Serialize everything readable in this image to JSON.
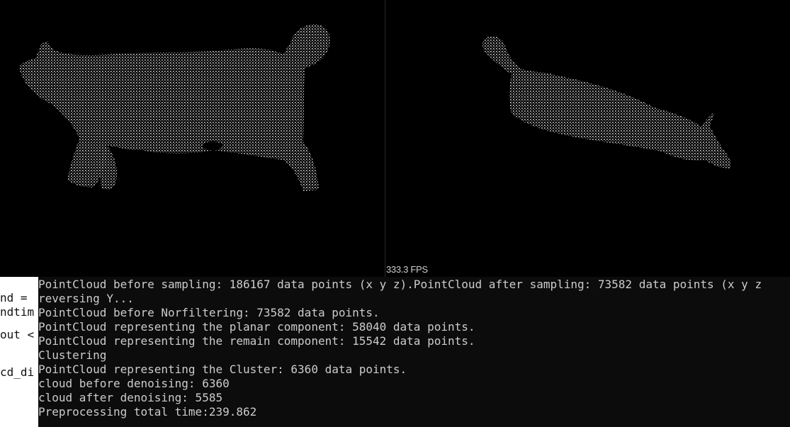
{
  "viewer": {
    "fps_label": "333.3 FPS",
    "left_view": "point-cloud-pig-side",
    "right_view": "point-cloud-pig-top",
    "background": "#000000",
    "point_color": "#d8d8d8"
  },
  "editor": {
    "lines": [
      "nd =",
      "ndtim",
      "out <",
      "",
      "cd_di"
    ]
  },
  "console": {
    "lines": [
      "PointCloud before sampling: 186167 data points (x y z).PointCloud after sampling: 73582 data points (x y z",
      "reversing Y...",
      "PointCloud before Norfiltering: 73582 data points.",
      "PointCloud representing the planar component: 58040 data points.",
      "PointCloud representing the remain component: 15542 data points.",
      "Clustering",
      "PointCloud representing the Cluster: 6360 data points.",
      "cloud before denoising: 6360",
      "cloud after denoising: 5585",
      "Preprocessing total time:239.862"
    ]
  }
}
